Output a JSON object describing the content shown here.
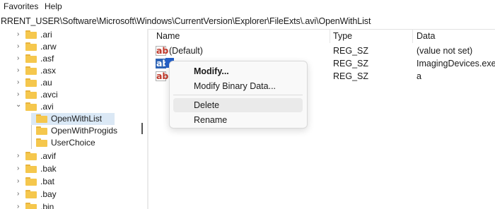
{
  "menubar": {
    "favorites": "Favorites",
    "help": "Help"
  },
  "address": "RRENT_USER\\Software\\Microsoft\\Windows\\CurrentVersion\\Explorer\\FileExts\\.avi\\OpenWithList",
  "tree": [
    {
      "label": ".ari",
      "chevron": "›",
      "level": 0
    },
    {
      "label": ".arw",
      "chevron": "›",
      "level": 0
    },
    {
      "label": ".asf",
      "chevron": "›",
      "level": 0
    },
    {
      "label": ".asx",
      "chevron": "›",
      "level": 0
    },
    {
      "label": ".au",
      "chevron": "›",
      "level": 0
    },
    {
      "label": ".avci",
      "chevron": "›",
      "level": 0
    },
    {
      "label": ".avi",
      "chevron": "⌄",
      "level": 0
    },
    {
      "label": "OpenWithList",
      "chevron": "",
      "level": 1,
      "selected": true
    },
    {
      "label": "OpenWithProgids",
      "chevron": "",
      "level": 1
    },
    {
      "label": "UserChoice",
      "chevron": "",
      "level": 1
    },
    {
      "label": ".avif",
      "chevron": "›",
      "level": 0
    },
    {
      "label": ".bak",
      "chevron": "›",
      "level": 0
    },
    {
      "label": ".bat",
      "chevron": "›",
      "level": 0
    },
    {
      "label": ".bay",
      "chevron": "›",
      "level": 0
    },
    {
      "label": ".bin",
      "chevron": "›",
      "level": 0
    }
  ],
  "columns": {
    "name": "Name",
    "type": "Type",
    "data": "Data"
  },
  "values": [
    {
      "name": "(Default)",
      "type": "REG_SZ",
      "data": "(value not set)",
      "icon": "ab-string-icon"
    },
    {
      "name": "",
      "type": "REG_SZ",
      "data": "ImagingDevices.exe",
      "icon": "ab-string-icon"
    },
    {
      "name": "",
      "type": "REG_SZ",
      "data": "a",
      "icon": "ab-string-icon"
    }
  ],
  "icon_text": "ab",
  "context_menu": {
    "modify": "Modify...",
    "modify_binary": "Modify Binary Data...",
    "delete": "Delete",
    "rename": "Rename"
  },
  "colors": {
    "folder": "#f5c74d",
    "selection": "#dbe8f5",
    "accent": "#2460c8"
  }
}
